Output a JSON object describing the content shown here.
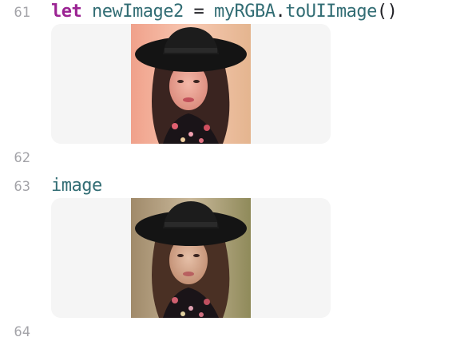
{
  "editor": {
    "lines": [
      {
        "number": "61",
        "tokens": {
          "keyword": "let",
          "identifier": "newImage2",
          "operator": "=",
          "receiver": "myRGBA",
          "dot": ".",
          "method": "toUIImage",
          "call": "()"
        }
      },
      {
        "number": "62"
      },
      {
        "number": "63",
        "tokens": {
          "identifier": "image"
        }
      },
      {
        "number": "64"
      }
    ],
    "results": [
      {
        "kind": "image-preview",
        "description_icon": "portrait-image",
        "tint": "pinkish-filtered"
      },
      {
        "kind": "image-preview",
        "description_icon": "portrait-image",
        "tint": "natural"
      }
    ]
  },
  "colors": {
    "keyword": "#9b2393",
    "identifier": "#326d74",
    "line_number": "#a3a3a8",
    "result_background": "#f5f5f5"
  }
}
